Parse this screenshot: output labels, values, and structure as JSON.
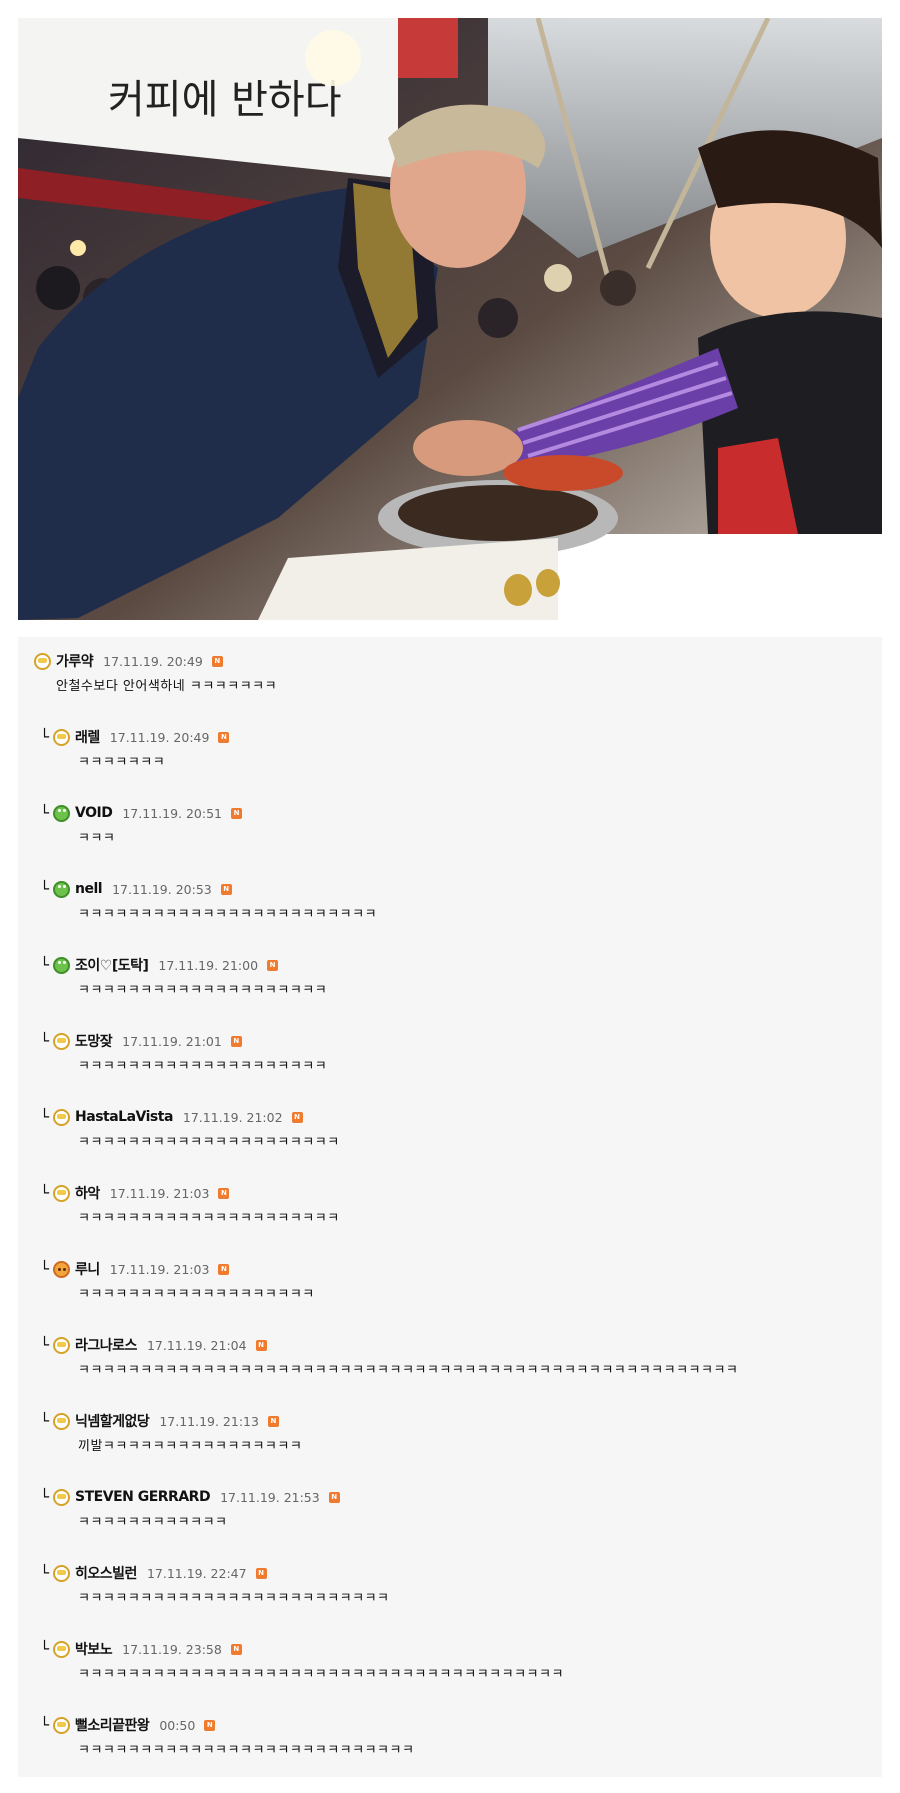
{
  "photo": {
    "sign_text": "커피에 반하다"
  },
  "comments": [
    {
      "nick": "가루약",
      "date": "17.11.19. 20:49",
      "badge": "N",
      "avatar": "cup-icon",
      "reply": false,
      "text": "안철수보다 안어색하네 ㅋㅋㅋㅋㅋㅋㅋ"
    },
    {
      "nick": "래렐",
      "date": "17.11.19. 20:49",
      "badge": "N",
      "avatar": "cup-icon",
      "reply": true,
      "text": "ㅋㅋㅋㅋㅋㅋㅋ"
    },
    {
      "nick": "VOID",
      "date": "17.11.19. 20:51",
      "badge": "N",
      "avatar": "frog-icon",
      "reply": true,
      "text": "ㅋㅋㅋ"
    },
    {
      "nick": "nell",
      "date": "17.11.19. 20:53",
      "badge": "N",
      "avatar": "frog-icon",
      "reply": true,
      "text": "ㅋㅋㅋㅋㅋㅋㅋㅋㅋㅋㅋㅋㅋㅋㅋㅋㅋㅋㅋㅋㅋㅋㅋㅋ"
    },
    {
      "nick": "조이♡[도탁]",
      "date": "17.11.19. 21:00",
      "badge": "N",
      "avatar": "frog-icon",
      "reply": true,
      "text": "ㅋㅋㅋㅋㅋㅋㅋㅋㅋㅋㅋㅋㅋㅋㅋㅋㅋㅋㅋㅋ"
    },
    {
      "nick": "도망잦",
      "date": "17.11.19. 21:01",
      "badge": "N",
      "avatar": "cup-icon",
      "reply": true,
      "text": "ㅋㅋㅋㅋㅋㅋㅋㅋㅋㅋㅋㅋㅋㅋㅋㅋㅋㅋㅋㅋ"
    },
    {
      "nick": "HastaLaVista",
      "date": "17.11.19. 21:02",
      "badge": "N",
      "avatar": "cup-icon",
      "reply": true,
      "text": "ㅋㅋㅋㅋㅋㅋㅋㅋㅋㅋㅋㅋㅋㅋㅋㅋㅋㅋㅋㅋㅋ"
    },
    {
      "nick": "하악",
      "date": "17.11.19. 21:03",
      "badge": "N",
      "avatar": "cup-icon",
      "reply": true,
      "text": "ㅋㅋㅋㅋㅋㅋㅋㅋㅋㅋㅋㅋㅋㅋㅋㅋㅋㅋㅋㅋㅋ"
    },
    {
      "nick": "루니",
      "date": "17.11.19. 21:03",
      "badge": "N",
      "avatar": "cat-icon",
      "reply": true,
      "text": "ㅋㅋㅋㅋㅋㅋㅋㅋㅋㅋㅋㅋㅋㅋㅋㅋㅋㅋㅋ"
    },
    {
      "nick": "라그나로스",
      "date": "17.11.19. 21:04",
      "badge": "N",
      "avatar": "cup-icon",
      "reply": true,
      "text": "ㅋㅋㅋㅋㅋㅋㅋㅋㅋㅋㅋㅋㅋㅋㅋㅋㅋㅋㅋㅋㅋㅋㅋㅋㅋㅋㅋㅋㅋㅋㅋㅋㅋㅋㅋㅋㅋㅋㅋㅋㅋㅋㅋㅋㅋㅋㅋㅋㅋㅋㅋㅋㅋ"
    },
    {
      "nick": "닉넴할게없당",
      "date": "17.11.19. 21:13",
      "badge": "N",
      "avatar": "cup-icon",
      "reply": true,
      "text": "끼발ㅋㅋㅋㅋㅋㅋㅋㅋㅋㅋㅋㅋㅋㅋㅋㅋ"
    },
    {
      "nick": "STEVEN GERRARD",
      "date": "17.11.19. 21:53",
      "badge": "N",
      "avatar": "cup-icon",
      "reply": true,
      "text": "ㅋㅋㅋㅋㅋㅋㅋㅋㅋㅋㅋㅋ"
    },
    {
      "nick": "히오스빌런",
      "date": "17.11.19. 22:47",
      "badge": "N",
      "avatar": "cup-icon",
      "reply": true,
      "text": "ㅋㅋㅋㅋㅋㅋㅋㅋㅋㅋㅋㅋㅋㅋㅋㅋㅋㅋㅋㅋㅋㅋㅋㅋㅋ"
    },
    {
      "nick": "박보노",
      "date": "17.11.19. 23:58",
      "badge": "N",
      "avatar": "cup-icon",
      "reply": true,
      "text": "ㅋㅋㅋㅋㅋㅋㅋㅋㅋㅋㅋㅋㅋㅋㅋㅋㅋㅋㅋㅋㅋㅋㅋㅋㅋㅋㅋㅋㅋㅋㅋㅋㅋㅋㅋㅋㅋㅋㅋ"
    },
    {
      "nick": "뻘소리끝판왕",
      "date": "00:50",
      "badge": "N",
      "avatar": "cup-icon",
      "reply": true,
      "text": "ㅋㅋㅋㅋㅋㅋㅋㅋㅋㅋㅋㅋㅋㅋㅋㅋㅋㅋㅋㅋㅋㅋㅋㅋㅋㅋㅋ"
    }
  ]
}
